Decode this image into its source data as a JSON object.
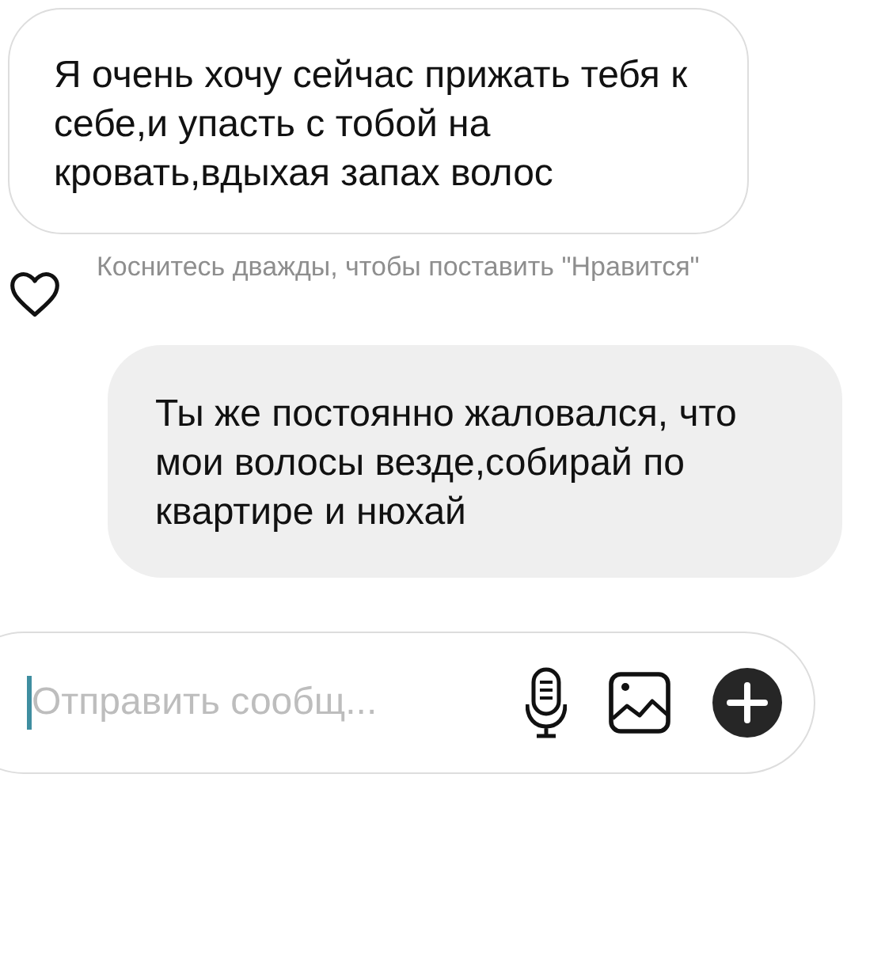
{
  "messages": [
    {
      "kind": "received",
      "text": "Я очень хочу сейчас прижать тебя к себе,и упасть с тобой на кровать,вдыхая запах волос",
      "hint": "Коснитесь дважды, чтобы поставить \"Нравится\""
    },
    {
      "kind": "sent",
      "text": "Ты же постоянно жаловался, что мои волосы везде,собирай по квартире и нюхай"
    }
  ],
  "composer": {
    "placeholder": "Отправить сообщ..."
  }
}
